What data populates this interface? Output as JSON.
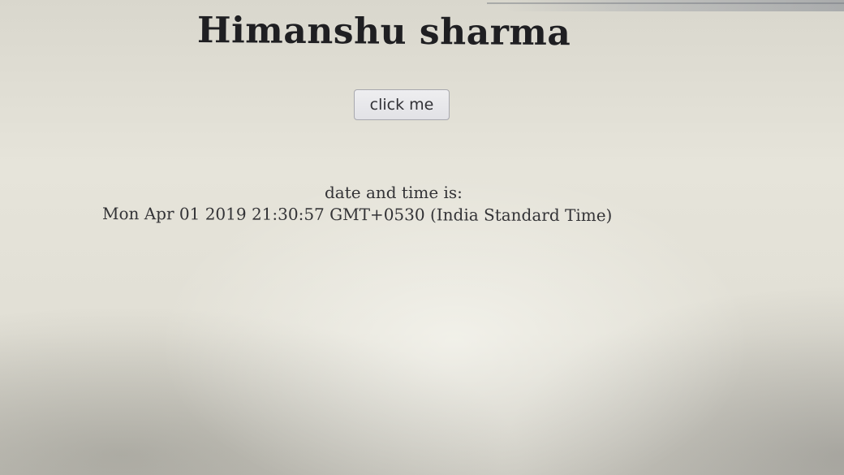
{
  "header": {
    "title": "Himanshu sharma"
  },
  "main": {
    "button_label": "click me",
    "datetime_label": "date and time is:",
    "datetime_value": "Mon Apr 01 2019 21:30:57 GMT+0530 (India Standard Time)"
  }
}
